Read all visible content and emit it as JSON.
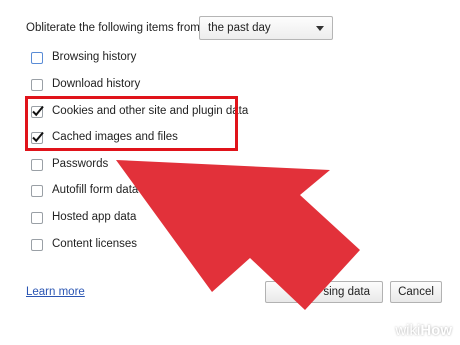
{
  "header": {
    "label": "Obliterate the following items from:",
    "time_range": {
      "selected": "the past day"
    }
  },
  "options": [
    {
      "label": "Browsing history",
      "checked": false
    },
    {
      "label": "Download history",
      "checked": false
    },
    {
      "label": "Cookies and other site and plugin data",
      "checked": true
    },
    {
      "label": "Cached images and files",
      "checked": true
    },
    {
      "label": "Passwords",
      "checked": false
    },
    {
      "label": "Autofill form data",
      "checked": false
    },
    {
      "label": "Hosted app data",
      "checked": false
    },
    {
      "label": "Content licenses",
      "checked": false
    }
  ],
  "footer": {
    "learn_more": "Learn more",
    "clear_label": "sing data",
    "cancel_label": "Cancel"
  },
  "annotation": {
    "highlight_color": "#e0131a",
    "arrow_color": "#e2313a"
  },
  "watermark": {
    "wiki": "wiki",
    "how": "How"
  }
}
